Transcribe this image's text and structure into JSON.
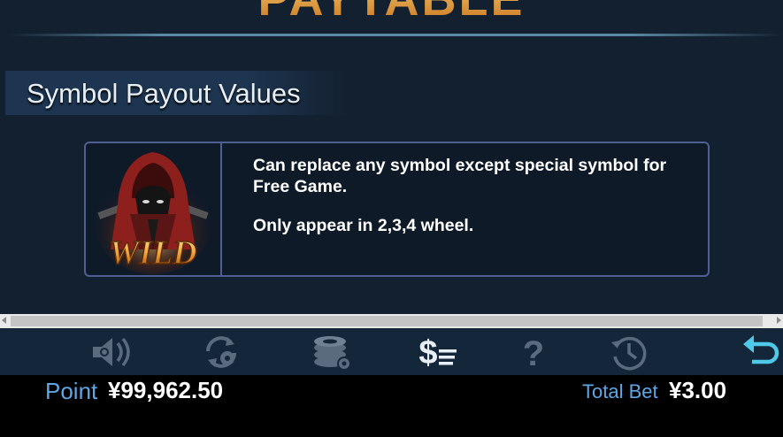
{
  "header": {
    "title": "PAYTABLE"
  },
  "section": {
    "title": "Symbol Payout Values"
  },
  "symbol_card": {
    "symbol_text": "WILD",
    "lines": [
      "Can replace any symbol except special symbol for Free Game.",
      "Only appear in 2,3,4 wheel."
    ]
  },
  "toolbar": {
    "items": [
      {
        "icon": "speaker-icon",
        "active": false
      },
      {
        "icon": "autoplay-icon",
        "active": false
      },
      {
        "icon": "chips-settings-icon",
        "active": false
      },
      {
        "icon": "paytable-icon",
        "active": true
      },
      {
        "icon": "help-icon",
        "active": false
      },
      {
        "icon": "history-icon",
        "active": false
      },
      {
        "icon": "back-icon",
        "active": true
      }
    ]
  },
  "footer": {
    "point_label": "Point",
    "point_value": "¥99,962.50",
    "bet_label": "Total Bet",
    "bet_value": "¥3.00"
  },
  "colors": {
    "background": "#13202f",
    "accent_blue": "#5fa7e4",
    "title_gold": "#d98a25",
    "card_border": "#4f5f93",
    "icon_inactive": "#5a6b7d",
    "back_icon": "#4ec9e8"
  }
}
